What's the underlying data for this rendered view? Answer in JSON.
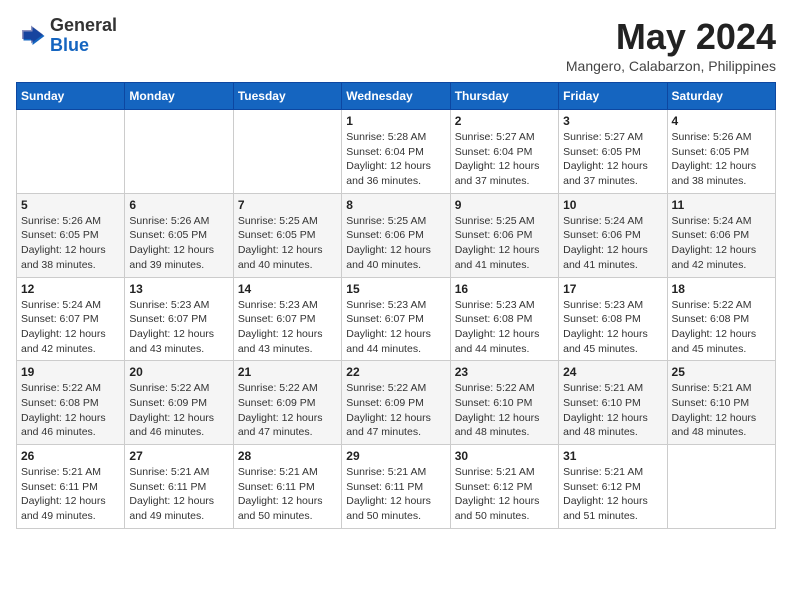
{
  "header": {
    "logo_general": "General",
    "logo_blue": "Blue",
    "month_title": "May 2024",
    "location": "Mangero, Calabarzon, Philippines"
  },
  "weekdays": [
    "Sunday",
    "Monday",
    "Tuesday",
    "Wednesday",
    "Thursday",
    "Friday",
    "Saturday"
  ],
  "weeks": [
    [
      {
        "day": "",
        "sunrise": "",
        "sunset": "",
        "daylight": ""
      },
      {
        "day": "",
        "sunrise": "",
        "sunset": "",
        "daylight": ""
      },
      {
        "day": "",
        "sunrise": "",
        "sunset": "",
        "daylight": ""
      },
      {
        "day": "1",
        "sunrise": "Sunrise: 5:28 AM",
        "sunset": "Sunset: 6:04 PM",
        "daylight": "Daylight: 12 hours and 36 minutes."
      },
      {
        "day": "2",
        "sunrise": "Sunrise: 5:27 AM",
        "sunset": "Sunset: 6:04 PM",
        "daylight": "Daylight: 12 hours and 37 minutes."
      },
      {
        "day": "3",
        "sunrise": "Sunrise: 5:27 AM",
        "sunset": "Sunset: 6:05 PM",
        "daylight": "Daylight: 12 hours and 37 minutes."
      },
      {
        "day": "4",
        "sunrise": "Sunrise: 5:26 AM",
        "sunset": "Sunset: 6:05 PM",
        "daylight": "Daylight: 12 hours and 38 minutes."
      }
    ],
    [
      {
        "day": "5",
        "sunrise": "Sunrise: 5:26 AM",
        "sunset": "Sunset: 6:05 PM",
        "daylight": "Daylight: 12 hours and 38 minutes."
      },
      {
        "day": "6",
        "sunrise": "Sunrise: 5:26 AM",
        "sunset": "Sunset: 6:05 PM",
        "daylight": "Daylight: 12 hours and 39 minutes."
      },
      {
        "day": "7",
        "sunrise": "Sunrise: 5:25 AM",
        "sunset": "Sunset: 6:05 PM",
        "daylight": "Daylight: 12 hours and 40 minutes."
      },
      {
        "day": "8",
        "sunrise": "Sunrise: 5:25 AM",
        "sunset": "Sunset: 6:06 PM",
        "daylight": "Daylight: 12 hours and 40 minutes."
      },
      {
        "day": "9",
        "sunrise": "Sunrise: 5:25 AM",
        "sunset": "Sunset: 6:06 PM",
        "daylight": "Daylight: 12 hours and 41 minutes."
      },
      {
        "day": "10",
        "sunrise": "Sunrise: 5:24 AM",
        "sunset": "Sunset: 6:06 PM",
        "daylight": "Daylight: 12 hours and 41 minutes."
      },
      {
        "day": "11",
        "sunrise": "Sunrise: 5:24 AM",
        "sunset": "Sunset: 6:06 PM",
        "daylight": "Daylight: 12 hours and 42 minutes."
      }
    ],
    [
      {
        "day": "12",
        "sunrise": "Sunrise: 5:24 AM",
        "sunset": "Sunset: 6:07 PM",
        "daylight": "Daylight: 12 hours and 42 minutes."
      },
      {
        "day": "13",
        "sunrise": "Sunrise: 5:23 AM",
        "sunset": "Sunset: 6:07 PM",
        "daylight": "Daylight: 12 hours and 43 minutes."
      },
      {
        "day": "14",
        "sunrise": "Sunrise: 5:23 AM",
        "sunset": "Sunset: 6:07 PM",
        "daylight": "Daylight: 12 hours and 43 minutes."
      },
      {
        "day": "15",
        "sunrise": "Sunrise: 5:23 AM",
        "sunset": "Sunset: 6:07 PM",
        "daylight": "Daylight: 12 hours and 44 minutes."
      },
      {
        "day": "16",
        "sunrise": "Sunrise: 5:23 AM",
        "sunset": "Sunset: 6:08 PM",
        "daylight": "Daylight: 12 hours and 44 minutes."
      },
      {
        "day": "17",
        "sunrise": "Sunrise: 5:23 AM",
        "sunset": "Sunset: 6:08 PM",
        "daylight": "Daylight: 12 hours and 45 minutes."
      },
      {
        "day": "18",
        "sunrise": "Sunrise: 5:22 AM",
        "sunset": "Sunset: 6:08 PM",
        "daylight": "Daylight: 12 hours and 45 minutes."
      }
    ],
    [
      {
        "day": "19",
        "sunrise": "Sunrise: 5:22 AM",
        "sunset": "Sunset: 6:08 PM",
        "daylight": "Daylight: 12 hours and 46 minutes."
      },
      {
        "day": "20",
        "sunrise": "Sunrise: 5:22 AM",
        "sunset": "Sunset: 6:09 PM",
        "daylight": "Daylight: 12 hours and 46 minutes."
      },
      {
        "day": "21",
        "sunrise": "Sunrise: 5:22 AM",
        "sunset": "Sunset: 6:09 PM",
        "daylight": "Daylight: 12 hours and 47 minutes."
      },
      {
        "day": "22",
        "sunrise": "Sunrise: 5:22 AM",
        "sunset": "Sunset: 6:09 PM",
        "daylight": "Daylight: 12 hours and 47 minutes."
      },
      {
        "day": "23",
        "sunrise": "Sunrise: 5:22 AM",
        "sunset": "Sunset: 6:10 PM",
        "daylight": "Daylight: 12 hours and 48 minutes."
      },
      {
        "day": "24",
        "sunrise": "Sunrise: 5:21 AM",
        "sunset": "Sunset: 6:10 PM",
        "daylight": "Daylight: 12 hours and 48 minutes."
      },
      {
        "day": "25",
        "sunrise": "Sunrise: 5:21 AM",
        "sunset": "Sunset: 6:10 PM",
        "daylight": "Daylight: 12 hours and 48 minutes."
      }
    ],
    [
      {
        "day": "26",
        "sunrise": "Sunrise: 5:21 AM",
        "sunset": "Sunset: 6:11 PM",
        "daylight": "Daylight: 12 hours and 49 minutes."
      },
      {
        "day": "27",
        "sunrise": "Sunrise: 5:21 AM",
        "sunset": "Sunset: 6:11 PM",
        "daylight": "Daylight: 12 hours and 49 minutes."
      },
      {
        "day": "28",
        "sunrise": "Sunrise: 5:21 AM",
        "sunset": "Sunset: 6:11 PM",
        "daylight": "Daylight: 12 hours and 50 minutes."
      },
      {
        "day": "29",
        "sunrise": "Sunrise: 5:21 AM",
        "sunset": "Sunset: 6:11 PM",
        "daylight": "Daylight: 12 hours and 50 minutes."
      },
      {
        "day": "30",
        "sunrise": "Sunrise: 5:21 AM",
        "sunset": "Sunset: 6:12 PM",
        "daylight": "Daylight: 12 hours and 50 minutes."
      },
      {
        "day": "31",
        "sunrise": "Sunrise: 5:21 AM",
        "sunset": "Sunset: 6:12 PM",
        "daylight": "Daylight: 12 hours and 51 minutes."
      },
      {
        "day": "",
        "sunrise": "",
        "sunset": "",
        "daylight": ""
      }
    ]
  ]
}
